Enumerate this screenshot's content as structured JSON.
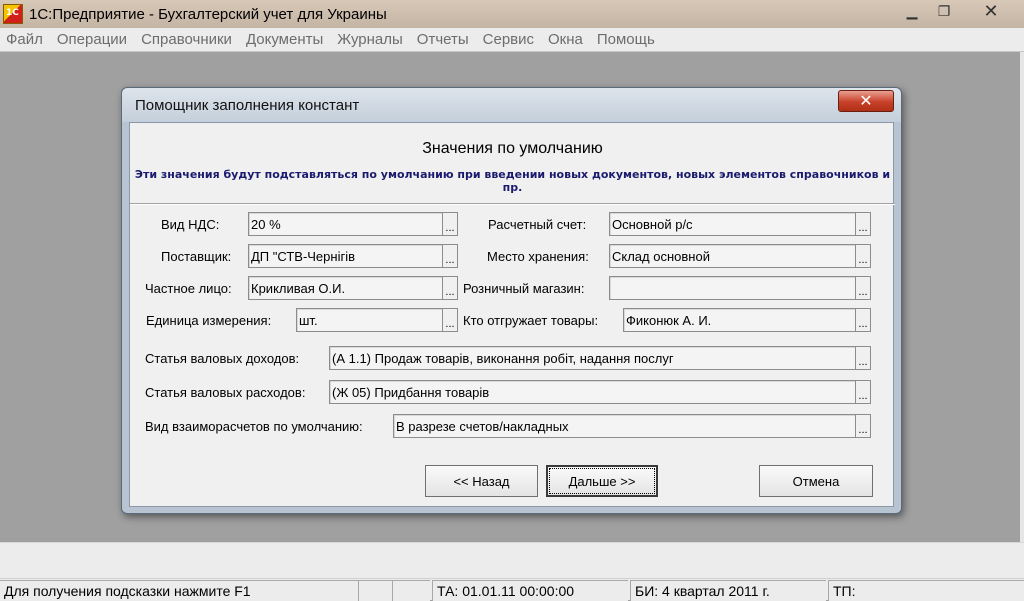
{
  "app": {
    "title": "1С:Предприятие - Бухгалтерский учет для Украины",
    "minimize": "▁",
    "maximize": "❐",
    "close": "✕"
  },
  "menu": [
    "Файл",
    "Операции",
    "Справочники",
    "Документы",
    "Журналы",
    "Отчеты",
    "Сервис",
    "Окна",
    "Помощь"
  ],
  "dialog": {
    "title": "Помощник заполнения констант",
    "close": "✕",
    "heading": "Значения по умолчанию",
    "subheading": "Эти значения будут подставляться по умолчанию при введении новых документов, новых элементов справочников и пр.",
    "pick_glyph": "...",
    "fields": {
      "vat_type": {
        "label": "Вид НДС:",
        "value": "20 %"
      },
      "supplier": {
        "label": "Поставщик:",
        "value": "ДП \"СТВ-Чернігів"
      },
      "private_person": {
        "label": "Частное лицо:",
        "value": "Крикливая О.И."
      },
      "unit": {
        "label": "Единица измерения:",
        "value": "шт."
      },
      "account": {
        "label": "Расчетный счет:",
        "value": "Основной р/с"
      },
      "storage": {
        "label": "Место хранения:",
        "value": "Склад основной"
      },
      "retail_store": {
        "label": "Розничный магазин:",
        "value": ""
      },
      "shipper": {
        "label": "Кто отгружает товары:",
        "value": "Фиконюк А. И."
      },
      "gross_income": {
        "label": "Статья валовых доходов:",
        "value": "(А 1.1) Продаж товарів, виконання робіт, надання послуг"
      },
      "gross_expense": {
        "label": "Статья валовых расходов:",
        "value": "(Ж 05) Придбання товарів"
      },
      "settlement_type": {
        "label": "Вид взаиморасчетов по умолчанию:",
        "value": "В разрезе счетов/накладных"
      }
    },
    "buttons": {
      "back": "<< Назад",
      "next": "Дальше >>",
      "cancel": "Отмена"
    }
  },
  "status": {
    "hint": "Для получения подсказки нажмите F1",
    "cell2": "",
    "cell3": "",
    "ta": "ТА: 01.01.11  00:00:00",
    "bi": "БИ: 4 квартал 2011 г.",
    "tp": "ТП:"
  }
}
